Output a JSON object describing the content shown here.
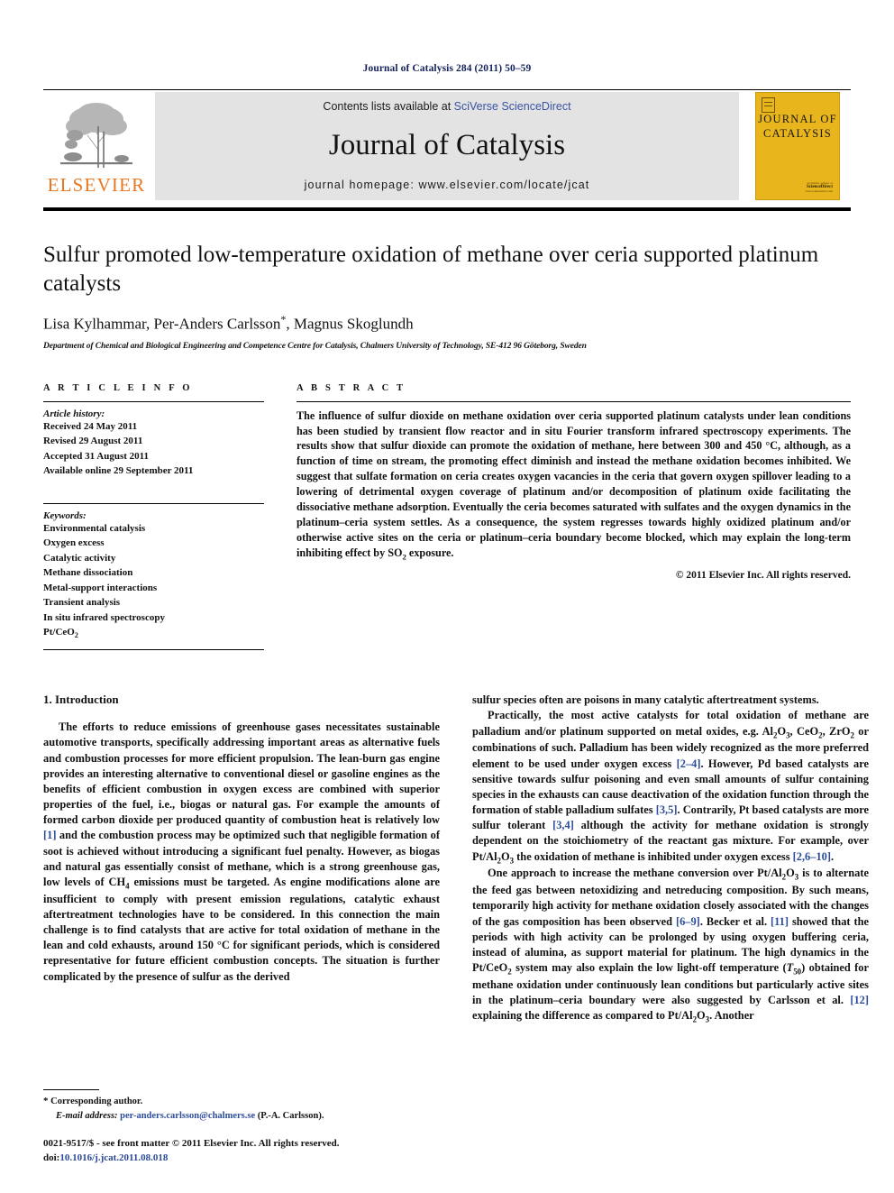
{
  "running_head": "Journal of Catalysis 284 (2011) 50–59",
  "masthead": {
    "publisher_name": "ELSEVIER",
    "contents_prefix": "Contents lists available at ",
    "contents_link": "SciVerse ScienceDirect",
    "journal_name": "Journal of Catalysis",
    "homepage_line": "journal homepage: www.elsevier.com/locate/jcat",
    "cover_title_line1": "JOURNAL OF",
    "cover_title_line2": "CATALYSIS",
    "cover_foot_1": "available online at",
    "cover_foot_2": "ScienceDirect",
    "cover_foot_3": "www.sciencedirect.com"
  },
  "title": "Sulfur promoted low-temperature oxidation of methane over ceria supported platinum catalysts",
  "authors": "Lisa Kylhammar, Per-Anders Carlsson",
  "authors_tail": ", Magnus Skoglundh",
  "author_star": "*",
  "affiliation": "Department of Chemical and Biological Engineering and Competence Centre for Catalysis, Chalmers University of Technology, SE-412 96 Göteborg, Sweden",
  "article_info": {
    "heading": "A R T I C L E   I N F O",
    "history_label": "Article history:",
    "history": [
      "Received 24 May 2011",
      "Revised 29 August 2011",
      "Accepted 31 August 2011",
      "Available online 29 September 2011"
    ],
    "keywords_label": "Keywords:",
    "keywords": [
      "Environmental catalysis",
      "Oxygen excess",
      "Catalytic activity",
      "Methane dissociation",
      "Metal-support interactions",
      "Transient analysis",
      "In situ infrared spectroscopy"
    ],
    "keyword_last": "Pt/CeO",
    "keyword_last_sub": "2"
  },
  "abstract": {
    "heading": "A B S T R A C T",
    "part1": "The influence of sulfur dioxide on methane oxidation over ceria supported platinum catalysts under lean conditions has been studied by transient flow reactor and in situ Fourier transform infrared spectroscopy experiments. The results show that sulfur dioxide can promote the oxidation of methane, here between 300 and 450 °C, although, as a function of time on stream, the promoting effect diminish and instead the methane oxidation becomes inhibited. We suggest that sulfate formation on ceria creates oxygen vacancies in the ceria that govern oxygen spillover leading to a lowering of detrimental oxygen coverage of platinum and/or decomposition of platinum oxide facilitating the dissociative methane adsorption. Eventually the ceria becomes saturated with sulfates and the oxygen dynamics in the platinum–ceria system settles. As a consequence, the system regresses towards highly oxidized platinum and/or otherwise active sites on the ceria or platinum–ceria boundary become blocked, which may explain the long-term inhibiting effect by SO",
    "part1_sub": "2",
    "part2": " exposure.",
    "copyright": "© 2011 Elsevier Inc. All rights reserved."
  },
  "body": {
    "section_number_title": "1. Introduction",
    "left_p1": "The efforts to reduce emissions of greenhouse gases necessitates sustainable automotive transports, specifically addressing important areas as alternative fuels and combustion processes for more efficient propulsion. The lean-burn gas engine provides an interesting alternative to conventional diesel or gasoline engines as the benefits of efficient combustion in oxygen excess are combined with superior properties of the fuel, i.e., biogas or natural gas. For example the amounts of formed carbon dioxide per produced quantity of combustion heat is relatively low ",
    "left_p1_ref": "[1]",
    "left_p1_cont": " and the combustion process may be optimized such that negligible formation of soot is achieved without introducing a significant fuel penalty. However, as biogas and natural gas essentially consist of methane, which is a strong greenhouse gas, low levels of CH",
    "left_p1_sub": "4",
    "left_p1_cont2": " emissions must be targeted. As engine modifications alone are insufficient to comply with present emission regulations, catalytic exhaust aftertreatment technologies have to be considered. In this connection the main challenge is to find catalysts that are active for total oxidation of methane in the lean and cold exhausts, around 150 °C for significant periods, which is considered representative for future efficient combustion concepts. The situation is further complicated by the presence of sulfur as the derived",
    "right_p0": "sulfur species often are poisons in many catalytic aftertreatment systems.",
    "right_p1_a": "Practically, the most active catalysts for total oxidation of methane are palladium and/or platinum supported on metal oxides, e.g. Al",
    "right_p1_b": "O",
    "right_p1_c": ", CeO",
    "right_p1_d": ", ZrO",
    "right_p1_e": " or combinations of such. Palladium has been widely recognized as the more preferred element to be used under oxygen excess ",
    "right_p1_ref1": "[2–4]",
    "right_p1_f": ". However, Pd based catalysts are sensitive towards sulfur poisoning and even small amounts of sulfur containing species in the exhausts can cause deactivation of the oxidation function through the formation of stable palladium sulfates ",
    "right_p1_ref2": "[3,5]",
    "right_p1_g": ". Contrarily, Pt based catalysts are more sulfur tolerant ",
    "right_p1_ref3": "[3,4]",
    "right_p1_h": " although the activity for methane oxidation is strongly dependent on the stoichiometry of the reactant gas mixture. For example, over Pt/Al",
    "right_p1_i": "O",
    "right_p1_j": " the oxidation of methane is inhibited under oxygen excess ",
    "right_p1_ref4": "[2,6–10]",
    "right_p1_k": ".",
    "right_p2_a": "One approach to increase the methane conversion over Pt/Al",
    "right_p2_b": "O",
    "right_p2_c": " is to alternate the feed gas between netoxidizing and netreducing composition. By such means, temporarily high activity for methane oxidation closely associated with the changes of the gas composition has been observed ",
    "right_p2_ref1": "[6–9]",
    "right_p2_d": ". Becker et al. ",
    "right_p2_ref2": "[11]",
    "right_p2_e": " showed that the periods with high activity can be prolonged by using oxygen buffering ceria, instead of alumina, as support material for platinum. The high dynamics in the Pt/CeO",
    "right_p2_f": " system may also explain the low light-off temperature (",
    "right_p2_t": "T",
    "right_p2_t_sub": "50",
    "right_p2_g": ") obtained for methane oxidation under continuously lean conditions but particularly active sites in the platinum–ceria boundary were also suggested by Carlsson et al. ",
    "right_p2_ref3": "[12]",
    "right_p2_h": " explaining the difference as compared to Pt/Al",
    "right_p2_i": "O",
    "right_p2_j": ". Another",
    "sub_2": "2",
    "sub_3": "3"
  },
  "footnote": {
    "star": "*",
    "corresponding": " Corresponding author.",
    "email_label": "E-mail address:",
    "email": "per-anders.carlsson@chalmers.se",
    "email_owner": "(P.-A. Carlsson).",
    "issn": "0021-9517/$ - see front matter © 2011 Elsevier Inc. All rights reserved.",
    "doi_label": "doi:",
    "doi": "10.1016/j.jcat.2011.08.018"
  },
  "colors": {
    "link_blue": "#2c4c9b",
    "header_navy": "#14215c",
    "elsevier_orange": "#e87722",
    "cover_gold": "#e8b51d",
    "banner_gray": "#e3e3e3"
  }
}
